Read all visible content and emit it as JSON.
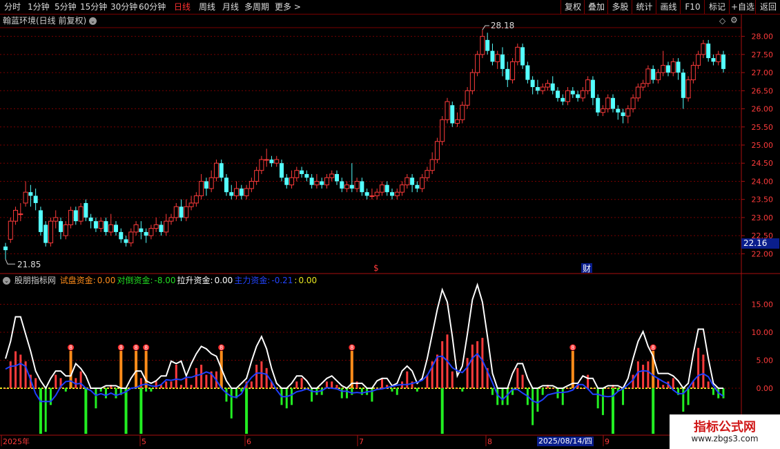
{
  "toolbar": {
    "periods": [
      "分时",
      "1分钟",
      "5分钟",
      "15分钟",
      "30分钟",
      "60分钟",
      "日线",
      "周线",
      "月线",
      "多周期",
      "更多 >"
    ],
    "active": "日线",
    "right_buttons": [
      "复权",
      "叠加",
      "多股",
      "统计",
      "画线",
      "F10",
      "标记",
      "+自选",
      "返回"
    ]
  },
  "title": {
    "name": "翰蓝环境(日线 前复权)"
  },
  "price_axis": {
    "ticks": [
      "28.00",
      "27.50",
      "27.00",
      "26.50",
      "26.00",
      "25.50",
      "25.00",
      "24.50",
      "24.00",
      "23.50",
      "23.00",
      "22.50",
      "22.00"
    ],
    "current": "22.16"
  },
  "annotations": {
    "high": "28.18",
    "low": "21.85",
    "marker_s": "$",
    "marker_cai": "财"
  },
  "indicator": {
    "name": "股朋指标网",
    "items": [
      {
        "label": "试盘资金:",
        "value": "0.00",
        "color": "#ff8c1a"
      },
      {
        "label": "对倒资金:",
        "value": "-8.00",
        "color": "#22dd22"
      },
      {
        "label": "拉升资金:",
        "value": "0.00",
        "color": "#ffffff"
      },
      {
        "label": "主力资金:",
        "value": "-0.21",
        "color": "#2244ff"
      },
      {
        "label": ":",
        "value": "0.00",
        "color": "#e8e820"
      }
    ],
    "ticks": [
      "15.00",
      "10.00",
      "5.00",
      "0.00"
    ],
    "signal_char": "8"
  },
  "date_axis": {
    "labels": [
      "2025年",
      "5",
      "6",
      "7",
      "8",
      "9"
    ],
    "cursor": "2025/08/14/四"
  },
  "watermark": {
    "line1": "指标公式网",
    "line2": "www.zbgs3.com"
  },
  "colors": {
    "up": "#ff3b3b",
    "down": "#54ffff",
    "grid": "#7a0000",
    "ma_white": "#ffffff",
    "ma_blue": "#2040ff",
    "green": "#22ee22",
    "orange": "#ff8c1a",
    "yellow": "#e8e820"
  },
  "chart_data": {
    "type": "candlestick",
    "ylim": [
      21.8,
      28.4
    ],
    "candles": [
      [
        22.2,
        22.1,
        22.3,
        21.85
      ],
      [
        22.4,
        22.9,
        23.0,
        22.3
      ],
      [
        22.9,
        23.2,
        23.3,
        22.8
      ],
      [
        23.1,
        23.1,
        23.4,
        22.9
      ],
      [
        23.4,
        23.7,
        24.0,
        23.3
      ],
      [
        23.7,
        23.6,
        23.9,
        23.3
      ],
      [
        23.6,
        23.4,
        23.8,
        23.2
      ],
      [
        23.2,
        22.6,
        23.3,
        22.5
      ],
      [
        22.8,
        22.3,
        22.9,
        22.2
      ],
      [
        22.3,
        22.9,
        23.0,
        22.2
      ],
      [
        22.9,
        23.0,
        23.2,
        22.7
      ],
      [
        22.9,
        22.6,
        23.0,
        22.4
      ],
      [
        22.5,
        22.8,
        22.9,
        22.4
      ],
      [
        22.8,
        23.2,
        23.3,
        22.7
      ],
      [
        23.2,
        22.9,
        23.3,
        22.8
      ],
      [
        22.9,
        23.3,
        23.4,
        22.8
      ],
      [
        23.4,
        23.0,
        23.5,
        22.9
      ],
      [
        23.0,
        22.9,
        23.1,
        22.7
      ],
      [
        22.9,
        22.7,
        23.0,
        22.6
      ],
      [
        22.7,
        22.9,
        23.0,
        22.6
      ],
      [
        22.9,
        22.6,
        23.0,
        22.5
      ],
      [
        22.6,
        22.8,
        23.1,
        22.5
      ],
      [
        22.8,
        22.6,
        22.9,
        22.5
      ],
      [
        22.6,
        22.4,
        22.7,
        22.3
      ],
      [
        22.4,
        22.3,
        22.5,
        22.2
      ],
      [
        22.3,
        22.6,
        22.7,
        22.2
      ],
      [
        22.6,
        22.8,
        22.9,
        22.5
      ],
      [
        22.7,
        22.6,
        22.9,
        22.4
      ],
      [
        22.6,
        22.5,
        22.7,
        22.3
      ],
      [
        22.5,
        22.7,
        22.8,
        22.4
      ],
      [
        22.7,
        22.8,
        23.0,
        22.6
      ],
      [
        22.8,
        22.6,
        22.9,
        22.5
      ],
      [
        22.6,
        22.9,
        23.1,
        22.5
      ],
      [
        22.9,
        23.0,
        23.1,
        22.8
      ],
      [
        23.0,
        23.3,
        23.4,
        22.9
      ],
      [
        23.3,
        23.0,
        23.5,
        22.9
      ],
      [
        23.0,
        23.3,
        23.5,
        22.9
      ],
      [
        23.3,
        23.4,
        23.6,
        23.2
      ],
      [
        23.4,
        23.6,
        23.7,
        23.3
      ],
      [
        23.6,
        24.0,
        24.2,
        23.5
      ],
      [
        24.0,
        23.8,
        24.1,
        23.6
      ],
      [
        23.8,
        24.1,
        24.3,
        23.7
      ],
      [
        24.1,
        24.5,
        24.6,
        24.0
      ],
      [
        24.5,
        24.1,
        24.6,
        24.0
      ],
      [
        24.1,
        23.7,
        24.2,
        23.6
      ],
      [
        23.7,
        23.6,
        23.9,
        23.5
      ],
      [
        23.6,
        23.8,
        24.0,
        23.5
      ],
      [
        23.8,
        23.6,
        23.9,
        23.5
      ],
      [
        23.6,
        23.8,
        23.9,
        23.5
      ],
      [
        23.8,
        24.0,
        24.1,
        23.7
      ],
      [
        24.0,
        24.3,
        24.4,
        23.9
      ],
      [
        24.3,
        24.6,
        24.7,
        24.2
      ],
      [
        24.6,
        24.6,
        24.9,
        24.4
      ],
      [
        24.6,
        24.5,
        24.7,
        24.4
      ],
      [
        24.5,
        24.6,
        24.7,
        24.4
      ],
      [
        24.5,
        24.1,
        24.6,
        24.0
      ],
      [
        24.1,
        23.9,
        24.2,
        23.8
      ],
      [
        23.9,
        24.1,
        24.3,
        23.8
      ],
      [
        24.1,
        24.3,
        24.4,
        24.0
      ],
      [
        24.3,
        24.2,
        24.4,
        24.1
      ],
      [
        24.2,
        24.1,
        24.3,
        24.0
      ],
      [
        24.1,
        23.9,
        24.2,
        23.8
      ],
      [
        23.9,
        24.0,
        24.2,
        23.8
      ],
      [
        24.0,
        23.9,
        24.1,
        23.8
      ],
      [
        23.9,
        24.1,
        24.2,
        23.8
      ],
      [
        24.1,
        24.2,
        24.3,
        24.0
      ],
      [
        24.2,
        24.0,
        24.3,
        23.9
      ],
      [
        24.0,
        23.8,
        24.1,
        23.7
      ],
      [
        23.8,
        23.9,
        24.0,
        23.7
      ],
      [
        23.9,
        23.8,
        24.5,
        23.7
      ],
      [
        23.8,
        24.0,
        24.1,
        23.7
      ],
      [
        24.0,
        23.7,
        24.1,
        23.6
      ],
      [
        23.7,
        23.6,
        23.8,
        23.5
      ],
      [
        23.6,
        23.6,
        23.8,
        23.5
      ],
      [
        23.6,
        23.7,
        23.8,
        23.5
      ],
      [
        23.7,
        23.9,
        24.0,
        23.6
      ],
      [
        23.9,
        23.7,
        24.0,
        23.6
      ],
      [
        23.7,
        23.6,
        23.8,
        23.5
      ],
      [
        23.6,
        23.7,
        23.8,
        23.5
      ],
      [
        23.7,
        23.9,
        24.0,
        23.6
      ],
      [
        23.9,
        24.1,
        24.2,
        23.8
      ],
      [
        24.1,
        23.9,
        24.2,
        23.7
      ],
      [
        23.9,
        23.8,
        24.0,
        23.7
      ],
      [
        23.8,
        24.1,
        24.2,
        23.7
      ],
      [
        24.1,
        24.3,
        24.4,
        24.0
      ],
      [
        24.3,
        24.6,
        24.8,
        24.2
      ],
      [
        24.6,
        25.1,
        25.2,
        24.5
      ],
      [
        25.1,
        25.7,
        25.8,
        25.0
      ],
      [
        25.7,
        26.2,
        26.3,
        25.6
      ],
      [
        26.1,
        25.6,
        26.2,
        25.5
      ],
      [
        25.6,
        25.7,
        25.9,
        25.5
      ],
      [
        25.7,
        26.1,
        26.2,
        25.6
      ],
      [
        26.1,
        26.5,
        26.6,
        26.0
      ],
      [
        26.5,
        27.0,
        27.1,
        26.4
      ],
      [
        27.0,
        27.5,
        27.6,
        26.9
      ],
      [
        27.5,
        28.0,
        28.18,
        27.4
      ],
      [
        27.9,
        27.6,
        28.1,
        27.5
      ],
      [
        27.6,
        27.3,
        27.8,
        27.2
      ],
      [
        27.3,
        27.5,
        27.6,
        27.1
      ],
      [
        27.5,
        27.1,
        27.7,
        26.9
      ],
      [
        27.1,
        26.8,
        27.3,
        26.6
      ],
      [
        26.8,
        27.3,
        27.4,
        26.7
      ],
      [
        27.3,
        27.7,
        27.8,
        27.2
      ],
      [
        27.7,
        27.2,
        27.8,
        27.1
      ],
      [
        27.2,
        26.8,
        27.3,
        26.7
      ],
      [
        26.8,
        26.6,
        26.9,
        26.4
      ],
      [
        26.6,
        26.5,
        26.8,
        26.4
      ],
      [
        26.5,
        26.6,
        26.7,
        26.4
      ],
      [
        26.6,
        26.7,
        26.8,
        26.5
      ],
      [
        26.7,
        26.5,
        26.9,
        26.4
      ],
      [
        26.5,
        26.3,
        26.6,
        26.2
      ],
      [
        26.3,
        26.2,
        26.4,
        26.1
      ],
      [
        26.2,
        26.5,
        26.6,
        26.1
      ],
      [
        26.5,
        26.4,
        26.6,
        26.3
      ],
      [
        26.4,
        26.3,
        26.5,
        26.2
      ],
      [
        26.3,
        26.5,
        26.6,
        26.2
      ],
      [
        26.5,
        26.8,
        26.9,
        26.4
      ],
      [
        26.8,
        26.3,
        26.9,
        26.1
      ],
      [
        26.3,
        25.9,
        26.4,
        25.8
      ],
      [
        25.9,
        26.0,
        26.1,
        25.8
      ],
      [
        26.0,
        26.3,
        26.4,
        25.9
      ],
      [
        26.3,
        26.0,
        26.4,
        25.9
      ],
      [
        26.0,
        25.9,
        26.1,
        25.7
      ],
      [
        25.9,
        25.8,
        26.0,
        25.6
      ],
      [
        25.8,
        26.0,
        26.1,
        25.6
      ],
      [
        26.0,
        26.3,
        26.4,
        25.9
      ],
      [
        26.3,
        26.6,
        26.7,
        26.2
      ],
      [
        26.6,
        26.7,
        26.8,
        26.5
      ],
      [
        26.7,
        27.1,
        27.2,
        26.6
      ],
      [
        27.1,
        26.8,
        27.2,
        26.7
      ],
      [
        26.8,
        27.0,
        27.1,
        26.7
      ],
      [
        27.0,
        27.2,
        27.6,
        26.9
      ],
      [
        27.2,
        27.0,
        27.3,
        26.9
      ],
      [
        27.0,
        27.3,
        27.4,
        26.9
      ],
      [
        27.3,
        27.0,
        27.4,
        26.8
      ],
      [
        27.0,
        26.3,
        27.1,
        26.0
      ],
      [
        26.3,
        26.8,
        26.9,
        26.2
      ],
      [
        26.8,
        27.2,
        27.3,
        26.7
      ],
      [
        27.2,
        27.5,
        27.6,
        27.1
      ],
      [
        27.5,
        27.8,
        27.9,
        27.4
      ],
      [
        27.8,
        27.4,
        27.9,
        27.3
      ],
      [
        27.4,
        27.3,
        27.5,
        27.2
      ],
      [
        27.3,
        27.5,
        27.6,
        27.2
      ],
      [
        27.5,
        27.1,
        27.6,
        27.0
      ]
    ]
  }
}
